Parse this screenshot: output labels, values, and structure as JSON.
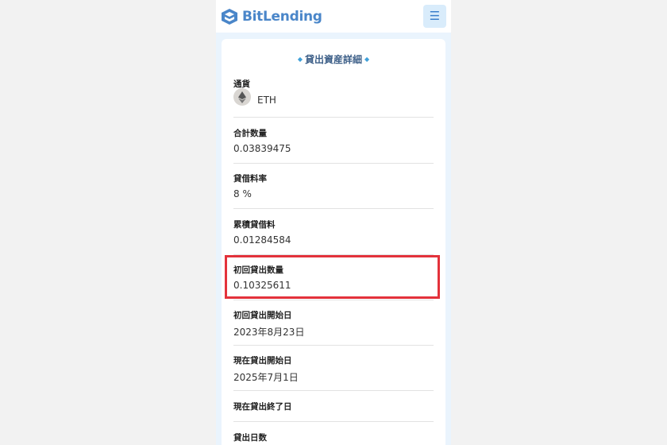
{
  "header": {
    "logo_text": "BitLending",
    "menu_icon": "hamburger-icon"
  },
  "card": {
    "title": "貸出資産詳細",
    "fields": [
      {
        "label": "通貨",
        "value": "ETH",
        "icon": "ethereum-icon"
      },
      {
        "label": "合計数量",
        "value": "0.03839475"
      },
      {
        "label": "貸借料率",
        "value": "8 %"
      },
      {
        "label": "累積貸借料",
        "value": "0.01284584"
      },
      {
        "label": "初回貸出数量",
        "value": "0.10325611"
      },
      {
        "label": "初回貸出開始日",
        "value": "2023年8月23日"
      },
      {
        "label": "現在貸出開始日",
        "value": "2025年7月1日"
      },
      {
        "label": "現在貸出終了日",
        "value": ""
      },
      {
        "label": "貸出日数",
        "value": ""
      }
    ]
  },
  "colors": {
    "brand": "#4a86c9",
    "highlight": "#e3323b",
    "page_bg": "#eaf4fd"
  }
}
